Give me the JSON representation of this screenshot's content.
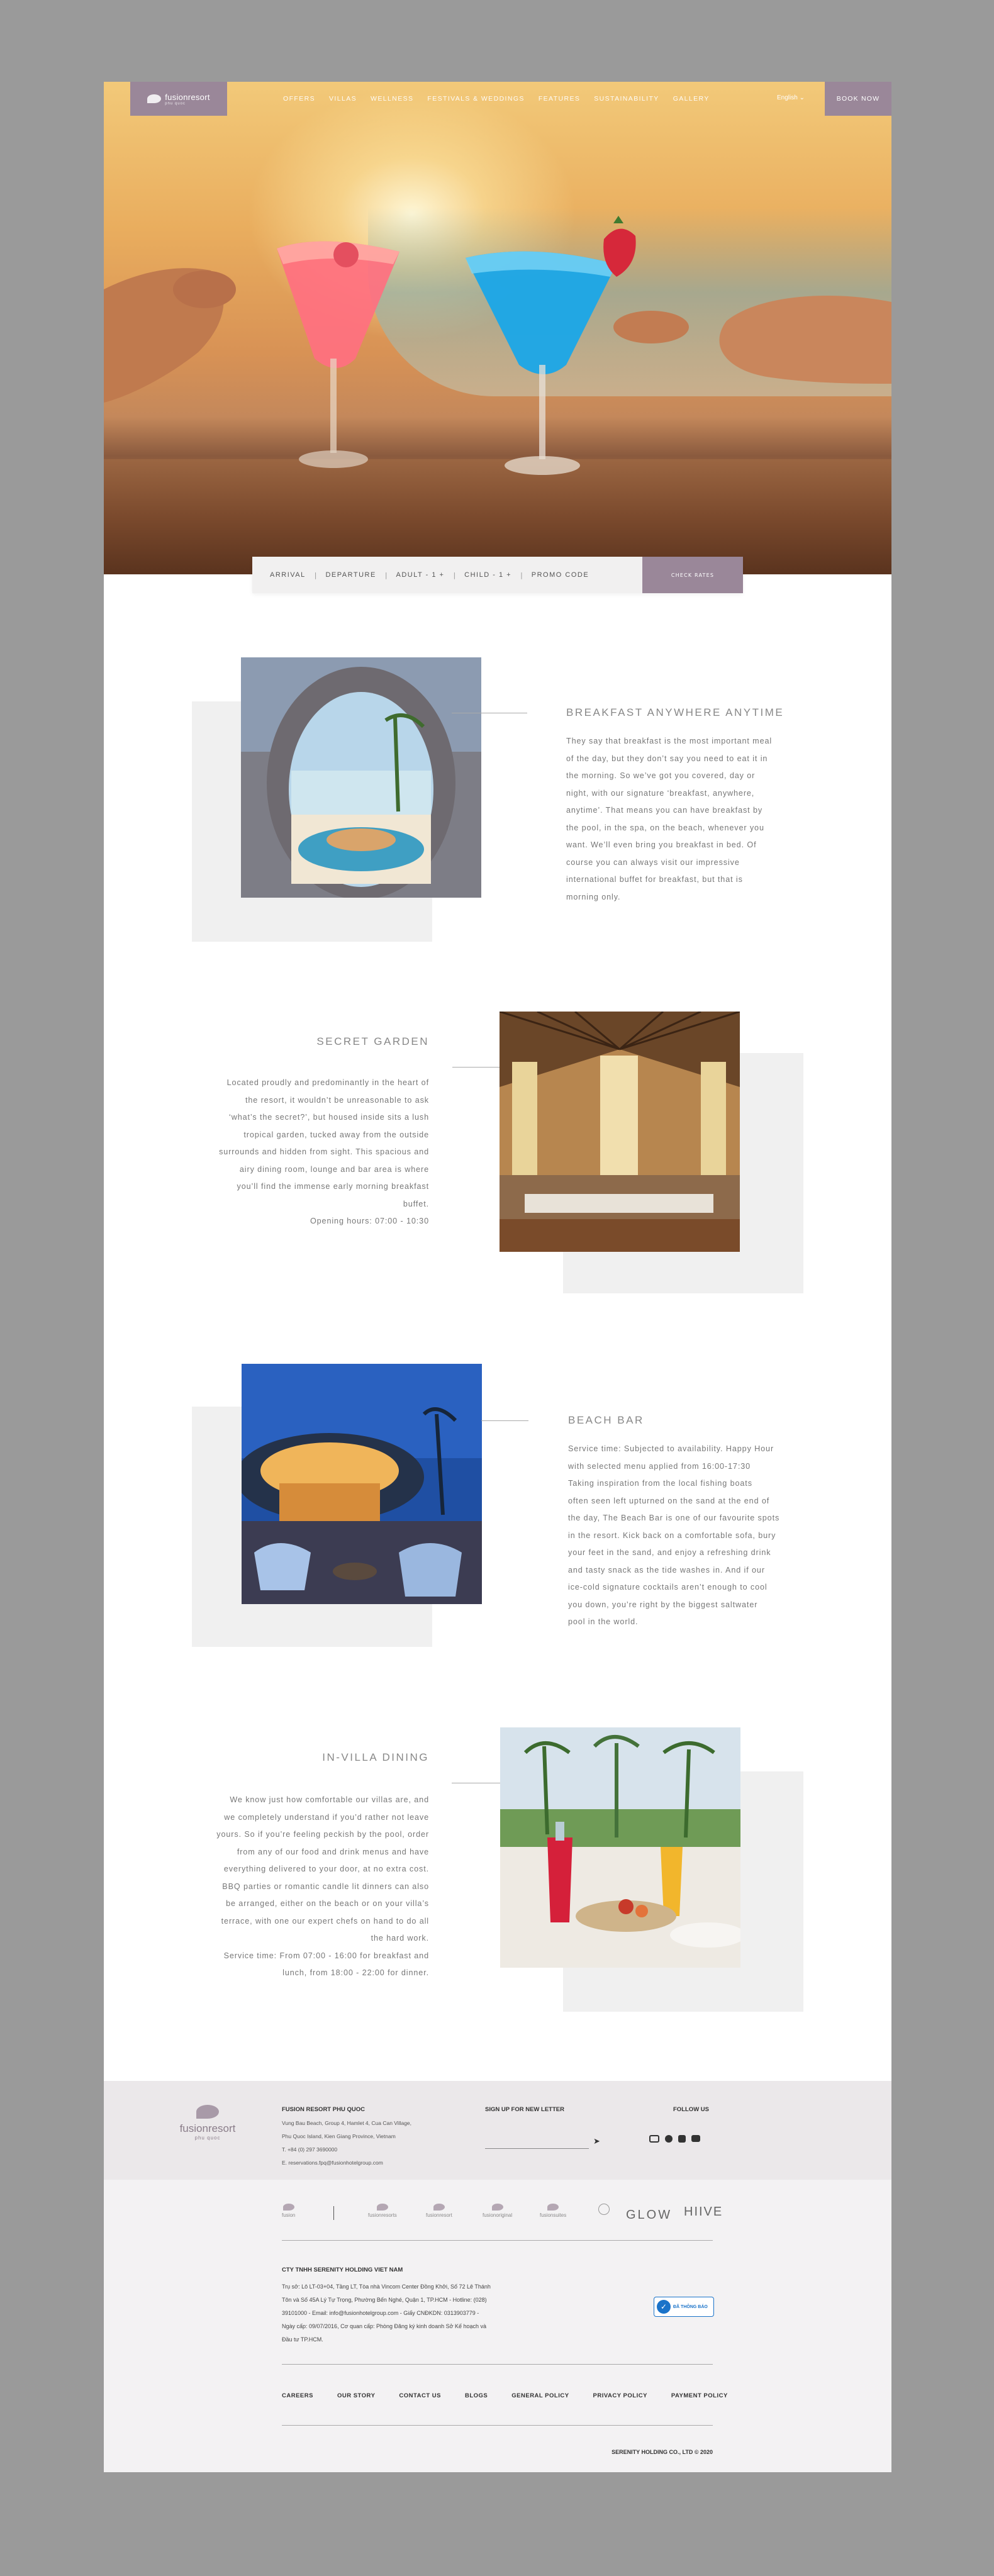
{
  "header": {
    "logo_name": "fusionresort",
    "logo_sub": "phu quoc",
    "nav": [
      "OFFERS",
      "VILLAS",
      "WELLNESS",
      "FESTIVALS & WEDDINGS",
      "FEATURES",
      "SUSTAINABILITY",
      "GALLERY"
    ],
    "language": "English",
    "book_now": "BOOK NOW"
  },
  "booking": {
    "arrival": "ARRIVAL",
    "departure": "DEPARTURE",
    "adult": "ADULT - 1 +",
    "child": "CHILD - 1 +",
    "promo": "PROMO CODE",
    "check": "CHECK RATES"
  },
  "sections": [
    {
      "title": "BREAKFAST ANYWHERE ANYTIME",
      "lines": [
        "They say that breakfast is the most important meal",
        "of the day, but they don’t say you need to eat it in",
        "the morning. So we’ve got you covered, day or",
        "night, with our signature ‘breakfast, anywhere,",
        "anytime’. That means you can have breakfast by",
        "the pool, in the spa, on the beach, whenever you",
        "want. We’ll even bring you breakfast in bed. Of",
        "course you can always visit our impressive",
        "international buffet for breakfast, but that is",
        "morning only."
      ]
    },
    {
      "title": "SECRET GARDEN",
      "lines": [
        "Located proudly and predominantly in the heart of",
        "the resort, it wouldn’t be unreasonable to ask",
        "‘what’s the secret?’, but housed inside sits a lush",
        "tropical garden, tucked away from the outside",
        "surrounds and hidden from sight. This spacious and",
        "airy dining room, lounge and bar area is where",
        "you’ll find the immense early morning breakfast",
        "buffet.",
        "Opening hours: 07:00 - 10:30"
      ]
    },
    {
      "title": "BEACH BAR",
      "lines": [
        "Service time: Subjected to availability. Happy Hour",
        "with selected menu applied from 16:00-17:30",
        "Taking inspiration from the local fishing boats",
        "often seen left upturned on the sand at the end of",
        "the day, The Beach Bar is one of our favourite spots",
        "in the resort. Kick back on a comfortable sofa, bury",
        "your feet in the sand, and enjoy a refreshing drink",
        "and tasty snack as the tide washes in. And if our",
        "ice-cold signature cocktails aren’t enough to cool",
        "you down, you’re right by the biggest saltwater",
        "pool in the world."
      ]
    },
    {
      "title": "IN-VILLA DINING",
      "lines": [
        "We know just how comfortable our villas are, and",
        "we completely understand if you’d rather not leave",
        "yours. So if you’re feeling peckish by the pool, order",
        "from any of our food and drink menus and have",
        "everything delivered to your door, at no extra cost.",
        "BBQ parties or romantic candle lit dinners can also",
        "be arranged, either on the beach or on your villa’s",
        "terrace, with one our expert chefs on hand to do all",
        "the hard work.",
        "Service time: From 07:00 - 16:00 for breakfast and",
        "lunch, from 18:00 - 22:00 for dinner."
      ]
    }
  ],
  "footer": {
    "logo_name": "fusionresort",
    "logo_sub": "phu quoc",
    "resort_title": "FUSION RESORT PHU QUOC",
    "address_1": "Vung Bau Beach, Group 4, Hamlet 4, Cua Can Village,",
    "address_2": "Phu Quoc Island, Kien Giang Province, Vietnam",
    "phone": "T. +84 (0) 297 3690000",
    "email": "E. reservations.fpq@fusionhotelgroup.com",
    "newsletter_title": "SIGN UP FOR NEW LETTER",
    "follow_title": "FOLLOW US",
    "brands": [
      "fusion",
      "fusionresorts",
      "fusionresort",
      "fusionoriginal",
      "fusionsuites",
      "",
      "GLOW",
      "HIIVE"
    ],
    "company_title": "CTY TNHH SERENITY HOLDING VIET NAM",
    "company_lines": [
      "Trụ sở: Lô LT-03+04, Tầng LT, Tòa nhà Vincom Center Đồng Khởi, Số 72 Lê Thánh",
      "Tôn và Số 45A Lý Tự Trọng, Phường Bến Nghé, Quận 1, TP.HCM - Hotline: (028)",
      "39101000 - Email: info@fusionhotelgroup.com - Giấy CNĐKDN: 0313903779 -",
      "Ngày cấp: 09/07/2016, Cơ quan cấp: Phòng Đăng ký kinh doanh Sở Kế hoạch và",
      "Đầu tư TP.HCM."
    ],
    "badge": "ĐÃ THÔNG BÁO",
    "links": [
      "CAREERS",
      "OUR STORY",
      "CONTACT US",
      "BLOGS",
      "GENERAL POLICY",
      "PRIVACY POLICY",
      "PAYMENT POLICY"
    ],
    "copyright": "SERENITY HOLDING CO., LTD © 2020"
  }
}
